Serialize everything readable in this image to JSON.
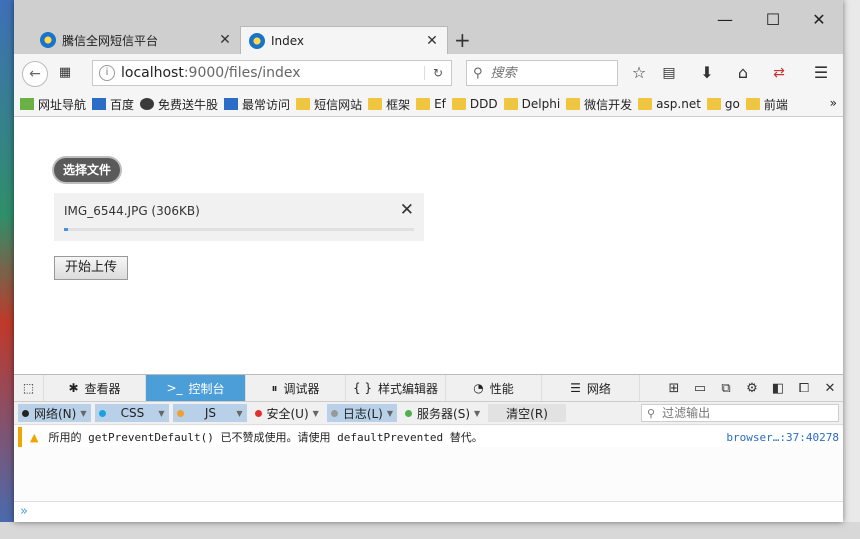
{
  "tabs": [
    {
      "label": "騰信全网短信平台"
    },
    {
      "label": "Index"
    }
  ],
  "window_controls": {
    "minimize": "—",
    "maximize": "☐",
    "close": "✕"
  },
  "nav": {
    "url_host": "localhost",
    "url_rest": ":9000/files/index",
    "search_placeholder": "搜索"
  },
  "bookmarks": [
    {
      "label": "网址导航",
      "icon": "site-nav-icon"
    },
    {
      "label": "百度",
      "icon": "baidu-paw-icon"
    },
    {
      "label": "免费送牛股",
      "icon": "stock-icon"
    },
    {
      "label": "最常访问",
      "icon": "frequent-icon"
    },
    {
      "label": "短信网站",
      "icon": "folder-icon"
    },
    {
      "label": "框架",
      "icon": "folder-icon"
    },
    {
      "label": "Ef",
      "icon": "folder-icon"
    },
    {
      "label": "DDD",
      "icon": "folder-icon"
    },
    {
      "label": "Delphi",
      "icon": "folder-icon"
    },
    {
      "label": "微信开发",
      "icon": "folder-icon"
    },
    {
      "label": "asp.net",
      "icon": "folder-icon"
    },
    {
      "label": "go",
      "icon": "folder-icon"
    },
    {
      "label": "前端",
      "icon": "folder-icon"
    }
  ],
  "bookmarks_overflow": "»",
  "page": {
    "pick_button": "选择文件",
    "file_name": "IMG_6544.JPG (306KB)",
    "progress_fraction": 0.01,
    "upload_button": "开始上传"
  },
  "devtools": {
    "tabs": [
      {
        "label": "查看器",
        "icon": "inspector-icon"
      },
      {
        "label": "控制台",
        "icon": "console-icon",
        "active": true
      },
      {
        "label": "调试器",
        "icon": "debugger-icon"
      },
      {
        "label": "样式编辑器",
        "icon": "style-editor-icon"
      },
      {
        "label": "性能",
        "icon": "performance-icon"
      },
      {
        "label": "网络",
        "icon": "network-icon"
      }
    ],
    "filters": [
      {
        "label": "网络(N)",
        "color": "#222222",
        "on": true
      },
      {
        "label": "CSS",
        "color": "#1ba1e2",
        "on": true
      },
      {
        "label": "JS",
        "color": "#f0a030",
        "on": true
      },
      {
        "label": "安全(U)",
        "color": "#e03030",
        "on": false
      },
      {
        "label": "日志(L)",
        "color": "#999999",
        "on": true
      },
      {
        "label": "服务器(S)",
        "color": "#4caf50",
        "on": false
      }
    ],
    "clear_label": "清空(R)",
    "filter_placeholder": "过滤输出",
    "message": "所用的 getPreventDefault() 已不赞成使用。请使用 defaultPrevented 替代。",
    "message_source": "browser…:37:40278",
    "prompt": "»"
  },
  "colors": {
    "accent": "#4c9ed9",
    "warning": "#f0a500"
  }
}
